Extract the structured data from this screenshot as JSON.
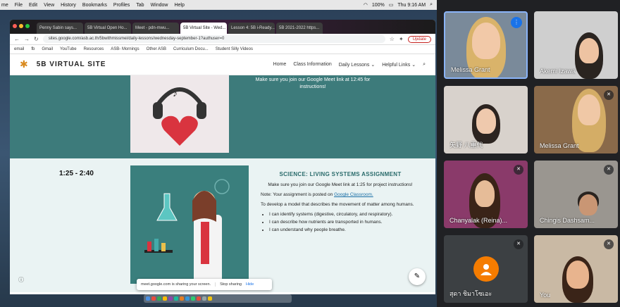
{
  "mac_menu": {
    "items": [
      "me",
      "File",
      "Edit",
      "View",
      "History",
      "Bookmarks",
      "Profiles",
      "Tab",
      "Window",
      "Help"
    ],
    "battery": "100%",
    "clock": "Thu 9:16 AM"
  },
  "browser": {
    "tabs": [
      "Penny Sabin says...",
      "5B Virtual Open Ho...",
      "Meet - pdn-mwu...",
      "5B Virtual Site - Wed...",
      "Lesson 4: 5B i-Ready...",
      "5B 2021-2022 https..."
    ],
    "active_tab_index": 3,
    "url": "sites.google.com/asb.ac.th/5bwithmissmei/daily-lessons/wednesday-september-1?authuser=0",
    "update_label": "Update",
    "bookmarks": [
      "email",
      "fb",
      "Gmail",
      "YouTube",
      "Resources",
      "ASB- Mornings",
      "Other ASB",
      "Curriculum Docu...",
      "Student Silly Videos"
    ]
  },
  "site": {
    "title": "5B VIRTUAL SITE",
    "nav": [
      "Home",
      "Class Information",
      "Daily Lessons",
      "Helpful Links"
    ],
    "section1_text": "Make sure you join our Google Meet link at 12:45 for instructions!",
    "time_slot": "1:25 - 2:40",
    "science_title": "SCIENCE: LIVING SYSTEMS ASSIGNMENT",
    "science_join": "Make sure you join our Google Meet link at 1:25 for project instructions!",
    "note_prefix": "Note: Your assignment is posted on",
    "note_link": "Google Classroom.",
    "develop": "To develop a model that describes the movement of matter among humans.",
    "bullets": [
      "I can identify systems (digestive, circulatory, and respiratory).",
      "I can describe how nutrients are transported in humans.",
      "I can understand why people breathe."
    ]
  },
  "share_bar": {
    "text": "meet.google.com is sharing your screen.",
    "stop": "Stop sharing",
    "hide": "Hide"
  },
  "participants": [
    {
      "name": "Melissa Grant",
      "speaking": true,
      "muted": false,
      "bg": "#7a8a9a",
      "skin": "#f2c9a8",
      "hair": "#d9b36a"
    },
    {
      "name": "Akemi Izawa",
      "speaking": false,
      "muted": false,
      "bg": "#cfcfcf",
      "skin": "#eec3a2",
      "hair": "#2a2420"
    },
    {
      "name": "矢野 八重代",
      "speaking": false,
      "muted": false,
      "bg": "#d8d2cc",
      "skin": "#efc9ad",
      "hair": "#2c2420"
    },
    {
      "name": "Melissa Grant",
      "speaking": false,
      "muted": true,
      "bg": "#8a6a4a",
      "skin": "#f0c8a6",
      "hair": "#d4ad66"
    },
    {
      "name": "Chanyalak (Reina)...",
      "speaking": false,
      "muted": true,
      "bg": "#8a3a6a",
      "skin": "#e6bc98",
      "hair": "#3a2418"
    },
    {
      "name": "Chingis Dashsam...",
      "speaking": false,
      "muted": true,
      "bg": "#9a9690",
      "skin": "#c99674",
      "hair": "#2a2420"
    },
    {
      "name": "สุดา ชิมาโซเอะ",
      "speaking": false,
      "muted": true,
      "avatar": true,
      "bg": "#3c4043"
    },
    {
      "name": "You",
      "speaking": false,
      "muted": true,
      "bg": "#c9b9a4",
      "skin": "#e8b48e",
      "hair": "#3a2418"
    }
  ]
}
